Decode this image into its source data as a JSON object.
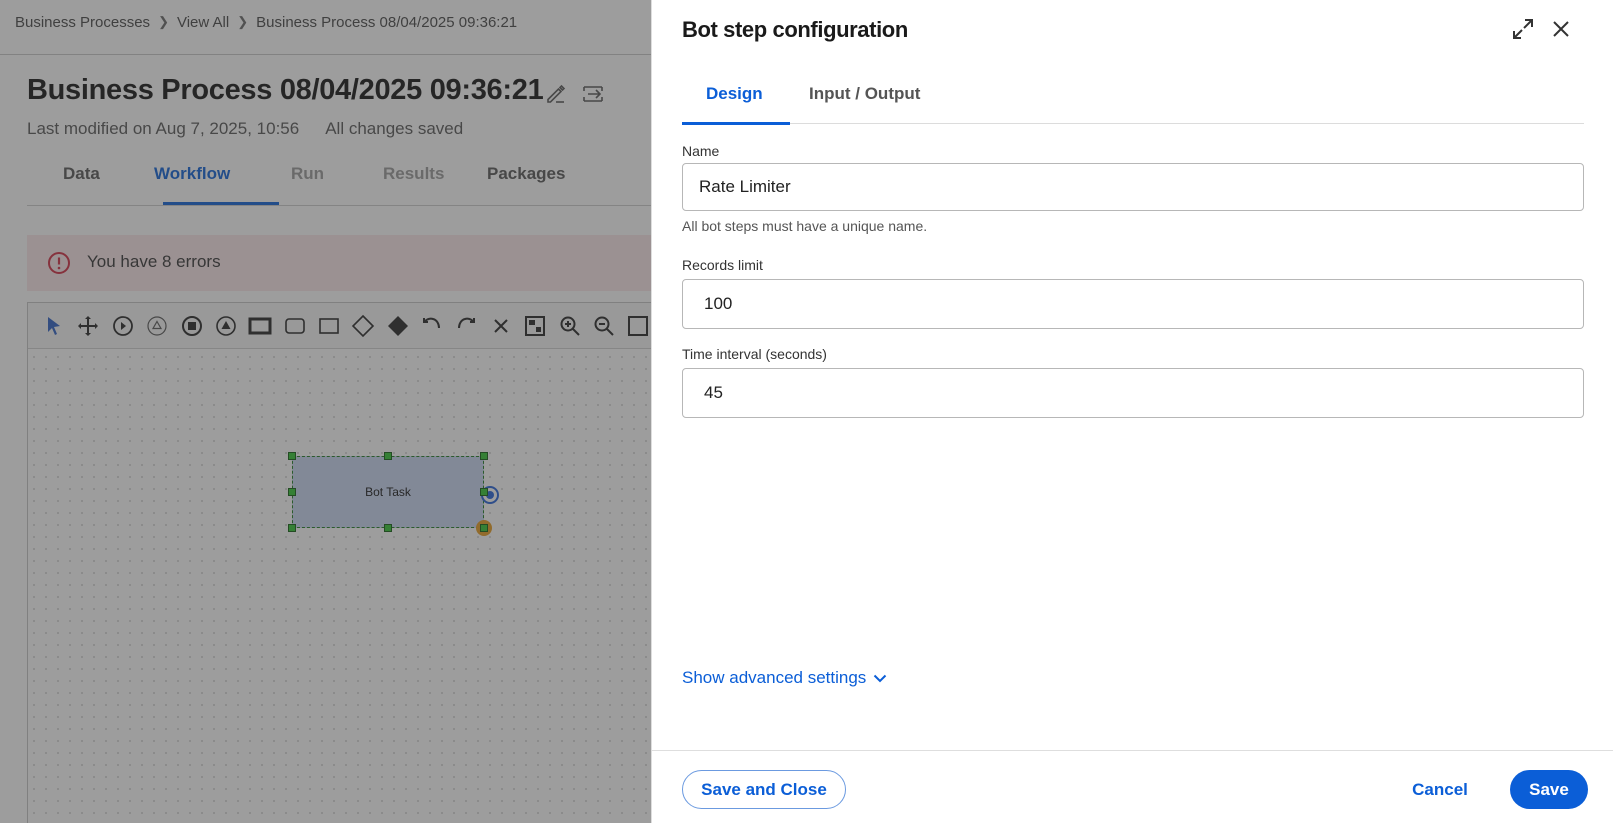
{
  "breadcrumb": {
    "items": [
      "Business Processes",
      "View All",
      "Business Process 08/04/2025 09:36:21"
    ]
  },
  "process": {
    "title": "Business Process 08/04/2025 09:36:21",
    "last_modified": "Last modified on Aug 7, 2025, 10:56",
    "save_status": "All changes saved"
  },
  "main_tabs": {
    "data": "Data",
    "workflow": "Workflow",
    "run": "Run",
    "results": "Results",
    "packages": "Packages",
    "active": "Workflow"
  },
  "errors": {
    "message": "You have 8 errors"
  },
  "canvas": {
    "toolbar_icons": [
      "pointer-icon",
      "move-icon",
      "start-event-icon",
      "intermediate-event-icon",
      "end-event-icon",
      "signal-event-icon",
      "task-icon",
      "subprocess-icon",
      "rectangle-icon",
      "gateway-icon",
      "exclusive-gateway-icon",
      "undo-icon",
      "redo-icon",
      "delete-icon",
      "minimap-icon",
      "zoom-in-icon",
      "zoom-out-icon"
    ],
    "node_label": "Bot Task"
  },
  "panel": {
    "title": "Bot step configuration",
    "tabs": {
      "design": "Design",
      "io": "Input / Output",
      "active": "Design"
    },
    "fields": {
      "name_label": "Name",
      "name_value": "Rate Limiter",
      "name_helper": "All bot steps must have a unique name.",
      "records_label": "Records limit",
      "records_value": "100",
      "interval_label": "Time interval (seconds)",
      "interval_value": "45"
    },
    "advanced_label": "Show advanced settings",
    "buttons": {
      "save_close": "Save and Close",
      "cancel": "Cancel",
      "save": "Save"
    }
  },
  "colors": {
    "accent": "#0b5ed7",
    "error_bg": "#fbe6e8",
    "error_icon": "#d0283f",
    "node_fill": "#c9d6f2",
    "handle": "#2ec52e"
  }
}
